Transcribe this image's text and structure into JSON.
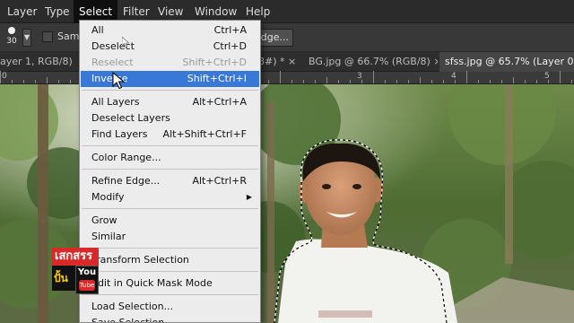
{
  "menubar": {
    "items": [
      "Layer",
      "Type",
      "Select",
      "Filter",
      "View",
      "Window",
      "Help"
    ],
    "active": "Select"
  },
  "options": {
    "brush_size": "30",
    "sample_label": "Sam",
    "refine_edge_label": "dge..."
  },
  "tabs": [
    {
      "label": "ayer 1, RGB/8) * ×"
    },
    {
      "label": "8#) * ×"
    },
    {
      "label": "BG.jpg @ 66.7% (RGB/8) ×"
    },
    {
      "label": "sfss.jpg @ 65.7% (Layer 0, RGE"
    }
  ],
  "ruler": {
    "labels": [
      "0",
      "3",
      "4",
      "5"
    ]
  },
  "select_menu": {
    "items": [
      {
        "label": "All",
        "shortcut": "Ctrl+A",
        "state": "normal"
      },
      {
        "label": "Deselect",
        "shortcut": "Ctrl+D",
        "state": "normal"
      },
      {
        "label": "Reselect",
        "shortcut": "Shift+Ctrl+D",
        "state": "disabled"
      },
      {
        "label": "Inverse",
        "shortcut": "Shift+Ctrl+I",
        "state": "highlighted"
      },
      {
        "label": "All Layers",
        "shortcut": "Alt+Ctrl+A",
        "state": "normal"
      },
      {
        "label": "Deselect Layers",
        "shortcut": "",
        "state": "normal"
      },
      {
        "label": "Find Layers",
        "shortcut": "Alt+Shift+Ctrl+F",
        "state": "normal"
      },
      {
        "label": "Color Range...",
        "shortcut": "",
        "state": "normal"
      },
      {
        "label": "Refine Edge...",
        "shortcut": "Alt+Ctrl+R",
        "state": "normal"
      },
      {
        "label": "Modify",
        "shortcut": "",
        "state": "submenu"
      },
      {
        "label": "Grow",
        "shortcut": "",
        "state": "normal"
      },
      {
        "label": "Similar",
        "shortcut": "",
        "state": "normal"
      },
      {
        "label": "Transform Selection",
        "shortcut": "",
        "state": "normal"
      },
      {
        "label": "Edit in Quick Mask Mode",
        "shortcut": "",
        "state": "normal"
      },
      {
        "label": "Load Selection...",
        "shortcut": "",
        "state": "normal"
      },
      {
        "label": "Save Selection...",
        "shortcut": "",
        "state": "normal"
      }
    ]
  },
  "logo": {
    "top_text": "เสกสรร",
    "bottom_text": "ปั้น",
    "youtube_you": "You",
    "youtube_tube": "Tube"
  },
  "colors": {
    "menu_highlight": "#3a78d8",
    "menu_background": "#ececec",
    "app_background": "#383838",
    "logo_red": "#d92a2a"
  },
  "icons": [
    "brush-preset-icon",
    "chevron-down-icon",
    "arrow-cursor-icon",
    "submenu-arrow-icon",
    "youtube-icon"
  ]
}
